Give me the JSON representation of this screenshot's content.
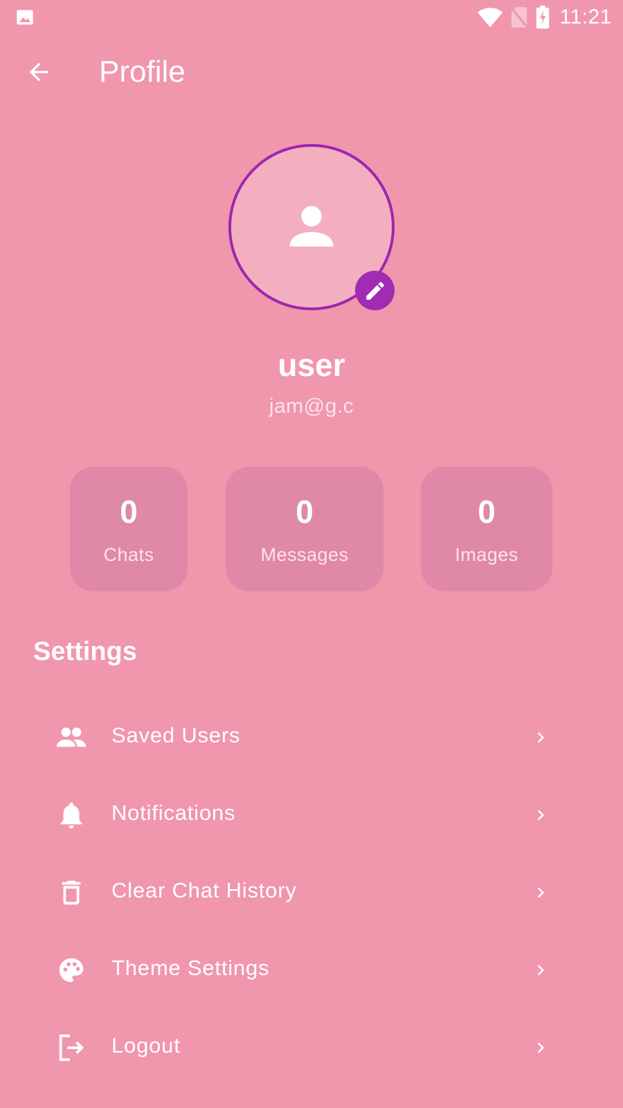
{
  "status_bar": {
    "time": "11:21",
    "icons": [
      "image-icon",
      "wifi-icon",
      "no-sim-icon",
      "battery-charging-icon"
    ]
  },
  "app_bar": {
    "back_icon": "arrow-back-icon",
    "title": "Profile"
  },
  "profile": {
    "avatar_icon": "person-icon",
    "edit_icon": "pencil-icon",
    "name": "user",
    "email": "jam@g.c"
  },
  "stats": [
    {
      "value": "0",
      "label": "Chats"
    },
    {
      "value": "0",
      "label": "Messages"
    },
    {
      "value": "0",
      "label": "Images"
    }
  ],
  "settings": {
    "title": "Settings",
    "items": [
      {
        "label": "Saved Users",
        "icon": "people-icon"
      },
      {
        "label": "Notifications",
        "icon": "bell-icon"
      },
      {
        "label": "Clear Chat History",
        "icon": "trash-icon"
      },
      {
        "label": "Theme Settings",
        "icon": "palette-icon"
      },
      {
        "label": "Logout",
        "icon": "logout-icon"
      }
    ]
  },
  "colors": {
    "background": "#f096ad",
    "card": "#e088a7",
    "accent": "#9c27b0",
    "avatar_fill": "#f3aec0",
    "text": "#ffffff",
    "muted_text": "#fde3ea"
  }
}
